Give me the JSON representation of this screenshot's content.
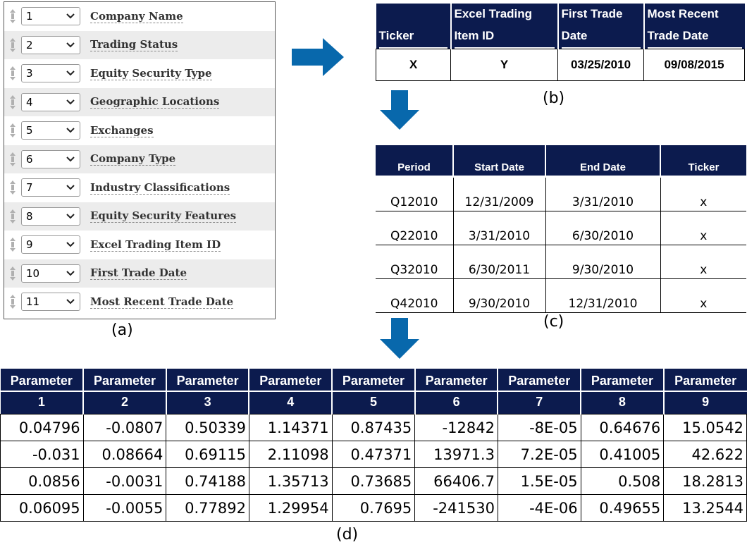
{
  "panel_a": {
    "caption": "(a)",
    "rows": [
      {
        "num": "1",
        "label": "Company Name"
      },
      {
        "num": "2",
        "label": "Trading Status"
      },
      {
        "num": "3",
        "label": "Equity Security Type"
      },
      {
        "num": "4",
        "label": "Geographic Locations"
      },
      {
        "num": "5",
        "label": "Exchanges"
      },
      {
        "num": "6",
        "label": "Company Type"
      },
      {
        "num": "7",
        "label": "Industry Classifications"
      },
      {
        "num": "8",
        "label": "Equity Security Features"
      },
      {
        "num": "9",
        "label": "Excel Trading Item ID"
      },
      {
        "num": "10",
        "label": "First Trade Date"
      },
      {
        "num": "11",
        "label": "Most Recent Trade Date"
      }
    ]
  },
  "panel_b": {
    "caption": "(b)",
    "headers": [
      "Ticker",
      "Excel Trading|Item ID",
      "First Trade|Date",
      "Most Recent|Trade Date"
    ],
    "row": [
      "X",
      "Y",
      "03/25/2010",
      "09/08/2015"
    ]
  },
  "panel_c": {
    "caption": "(c)",
    "headers": [
      "Period",
      "Start Date",
      "End Date",
      "Ticker"
    ],
    "rows": [
      [
        "Q12010",
        "12/31/2009",
        "3/31/2010",
        "x"
      ],
      [
        "Q22010",
        "3/31/2010",
        "6/30/2010",
        "x"
      ],
      [
        "Q32010",
        "6/30/2011",
        "9/30/2010",
        "x"
      ],
      [
        "Q42010",
        "9/30/2010",
        "12/31/2010",
        "x"
      ]
    ]
  },
  "panel_d": {
    "caption": "(d)",
    "header_word": "Parameter",
    "header_nums": [
      "1",
      "2",
      "3",
      "4",
      "5",
      "6",
      "7",
      "8",
      "9"
    ],
    "rows": [
      [
        "0.04796",
        "-0.0807",
        "0.50339",
        "1.14371",
        "0.87435",
        "-12842",
        "-8E-05",
        "0.64676",
        "15.0542"
      ],
      [
        "-0.031",
        "0.08664",
        "0.69115",
        "2.11098",
        "0.47371",
        "13971.3",
        "7.2E-05",
        "0.41005",
        "42.622"
      ],
      [
        "0.0856",
        "-0.0031",
        "0.74188",
        "1.35713",
        "0.73685",
        "66406.7",
        "1.5E-05",
        "0.508",
        "18.2813"
      ],
      [
        "0.06095",
        "-0.0055",
        "0.77892",
        "1.29954",
        "0.7695",
        "-241530",
        "-4E-06",
        "0.49655",
        "13.2544"
      ]
    ]
  },
  "colors": {
    "header_bg": "#0c1b4e",
    "arrow": "#0868ac",
    "row_shade": "#ececec"
  },
  "icons": {
    "drag": "drag-handle-icon",
    "chevron": "chevron-down-icon",
    "arrow_right": "arrow-right-icon",
    "arrow_down": "arrow-down-icon"
  }
}
